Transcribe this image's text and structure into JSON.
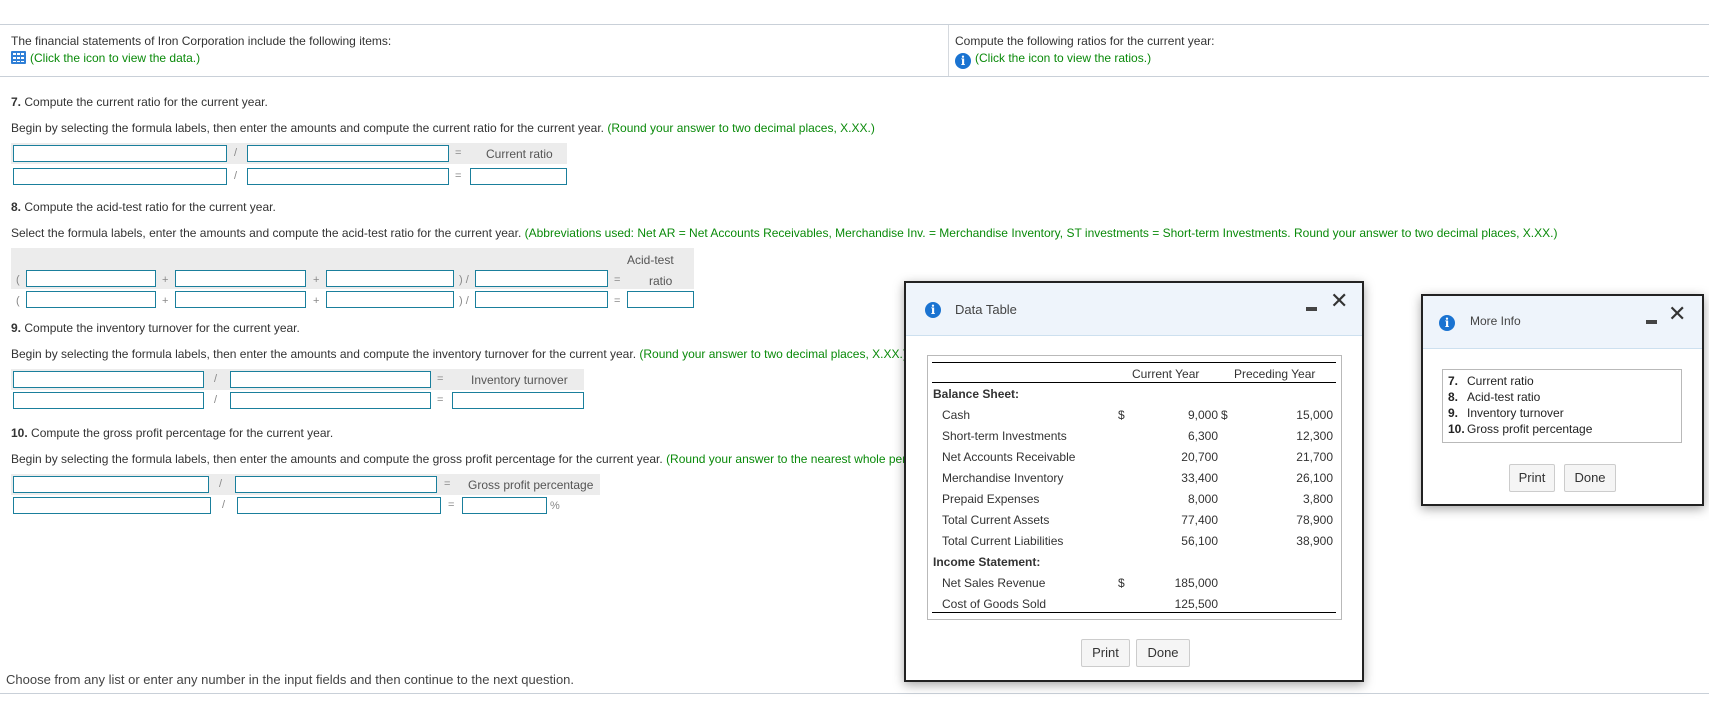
{
  "header": {
    "left_prompt": "The financial statements of Iron Corporation include the following items:",
    "left_link": "(Click the icon to view the data.)",
    "left_icon": "table-grid-icon",
    "right_prompt": "Compute the following ratios for the current year:",
    "right_link": "(Click the icon to view the ratios.)",
    "right_icon": "info-icon"
  },
  "questions": {
    "q7": {
      "number": "7.",
      "title": "Compute the current ratio for the current year.",
      "instruction": "Begin by selecting the formula labels, then enter the amounts and compute the current ratio for the current year.",
      "hint": "(Round your answer to two decimal places, X.XX.)",
      "operator": "/",
      "equals": "=",
      "result_label": "Current ratio"
    },
    "q8": {
      "number": "8.",
      "title": "Compute the acid-test ratio for the current year.",
      "instruction": "Select the formula labels, enter the amounts and compute the acid-test ratio for the current year.",
      "hint": "(Abbreviations used: Net AR = Net Accounts Receivables, Merchandise Inv. = Merchandise Inventory, ST investments = Short-term Investments. Round your answer to two decimal places, X.XX.)",
      "open_paren": "(",
      "plus": "+",
      "close_div": ") /",
      "equals": "=",
      "result_label_line1": "Acid-test",
      "result_label_line2": "ratio"
    },
    "q9": {
      "number": "9.",
      "title": "Compute the inventory turnover for the current year.",
      "instruction": "Begin by selecting the formula labels, then enter the amounts and compute the inventory turnover for the current year.",
      "hint": "(Round your answer to two decimal places, X.XX.)",
      "operator": "/",
      "equals": "=",
      "result_label": "Inventory turnover"
    },
    "q10": {
      "number": "10.",
      "title": "Compute the gross profit percentage for the current year.",
      "instruction": "Begin by selecting the formula labels, then enter the amounts and compute the gross profit percentage for the current year.",
      "hint": "(Round your answer to the nearest whole percent.)",
      "operator": "/",
      "equals": "=",
      "result_label": "Gross profit percentage",
      "suffix": "%"
    }
  },
  "footer": {
    "text": "Choose from any list or enter any number in the input fields and then continue to the next question."
  },
  "data_table_modal": {
    "title": "Data Table",
    "columns": [
      "Current Year",
      "Preceding Year"
    ],
    "sections": [
      {
        "heading": "Balance Sheet:",
        "rows": [
          {
            "label": "Cash",
            "cur_sign": "$",
            "current": "9,000",
            "prev_sign": "$",
            "preceding": "15,000"
          },
          {
            "label": "Short-term Investments",
            "cur_sign": "",
            "current": "6,300",
            "prev_sign": "",
            "preceding": "12,300"
          },
          {
            "label": "Net Accounts Receivable",
            "cur_sign": "",
            "current": "20,700",
            "prev_sign": "",
            "preceding": "21,700"
          },
          {
            "label": "Merchandise Inventory",
            "cur_sign": "",
            "current": "33,400",
            "prev_sign": "",
            "preceding": "26,100"
          },
          {
            "label": "Prepaid Expenses",
            "cur_sign": "",
            "current": "8,000",
            "prev_sign": "",
            "preceding": "3,800"
          },
          {
            "label": "Total Current Assets",
            "cur_sign": "",
            "current": "77,400",
            "prev_sign": "",
            "preceding": "78,900"
          },
          {
            "label": "Total Current Liabilities",
            "cur_sign": "",
            "current": "56,100",
            "prev_sign": "",
            "preceding": "38,900"
          }
        ]
      },
      {
        "heading": "Income Statement:",
        "rows": [
          {
            "label": "Net Sales Revenue",
            "cur_sign": "$",
            "current": "185,000",
            "prev_sign": "",
            "preceding": ""
          },
          {
            "label": "Cost of Goods Sold",
            "cur_sign": "",
            "current": "125,500",
            "prev_sign": "",
            "preceding": ""
          }
        ]
      }
    ],
    "print_label": "Print",
    "done_label": "Done"
  },
  "more_info_modal": {
    "title": "More Info",
    "items": [
      {
        "num": "7.",
        "text": "Current ratio"
      },
      {
        "num": "8.",
        "text": "Acid-test ratio"
      },
      {
        "num": "9.",
        "text": "Inventory turnover"
      },
      {
        "num": "10.",
        "text": "Gross profit percentage"
      }
    ],
    "print_label": "Print",
    "done_label": "Done"
  }
}
